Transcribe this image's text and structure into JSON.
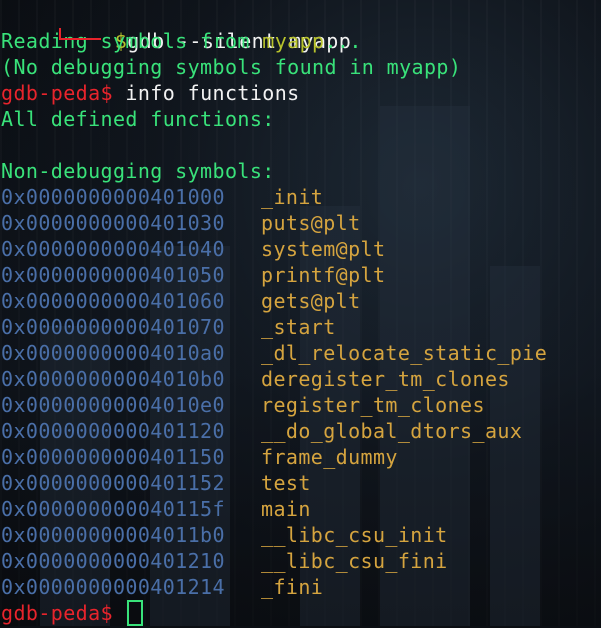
{
  "colors": {
    "prompt_red": "#e8242c",
    "text_green": "#39e27a",
    "binary_name": "#b7c22c",
    "address_blue": "#4a6fa8",
    "symbol_yellow": "#d5a43f"
  },
  "terminal": {
    "top_command": {
      "dollar": "$",
      "command": "gdb --silent myapp"
    },
    "reading": {
      "prefix": "Reading symbols from ",
      "file": "myapp",
      "suffix": "..."
    },
    "no_debug": "(No debugging symbols found in myapp)",
    "prompt": "gdb-peda$",
    "command2": " info functions",
    "all_defined": "All defined functions:",
    "non_debugging_header": "Non-debugging symbols:",
    "functions": [
      {
        "address": "0x0000000000401000",
        "name": "_init"
      },
      {
        "address": "0x0000000000401030",
        "name": "puts@plt"
      },
      {
        "address": "0x0000000000401040",
        "name": "system@plt"
      },
      {
        "address": "0x0000000000401050",
        "name": "printf@plt"
      },
      {
        "address": "0x0000000000401060",
        "name": "gets@plt"
      },
      {
        "address": "0x0000000000401070",
        "name": "_start"
      },
      {
        "address": "0x00000000004010a0",
        "name": "_dl_relocate_static_pie"
      },
      {
        "address": "0x00000000004010b0",
        "name": "deregister_tm_clones"
      },
      {
        "address": "0x00000000004010e0",
        "name": "register_tm_clones"
      },
      {
        "address": "0x0000000000401120",
        "name": "__do_global_dtors_aux"
      },
      {
        "address": "0x0000000000401150",
        "name": "frame_dummy"
      },
      {
        "address": "0x0000000000401152",
        "name": "test"
      },
      {
        "address": "0x000000000040115f",
        "name": "main"
      },
      {
        "address": "0x00000000004011b0",
        "name": "__libc_csu_init"
      },
      {
        "address": "0x0000000000401210",
        "name": "__libc_csu_fini"
      },
      {
        "address": "0x0000000000401214",
        "name": "_fini"
      }
    ],
    "final_prompt": "gdb-peda$"
  }
}
